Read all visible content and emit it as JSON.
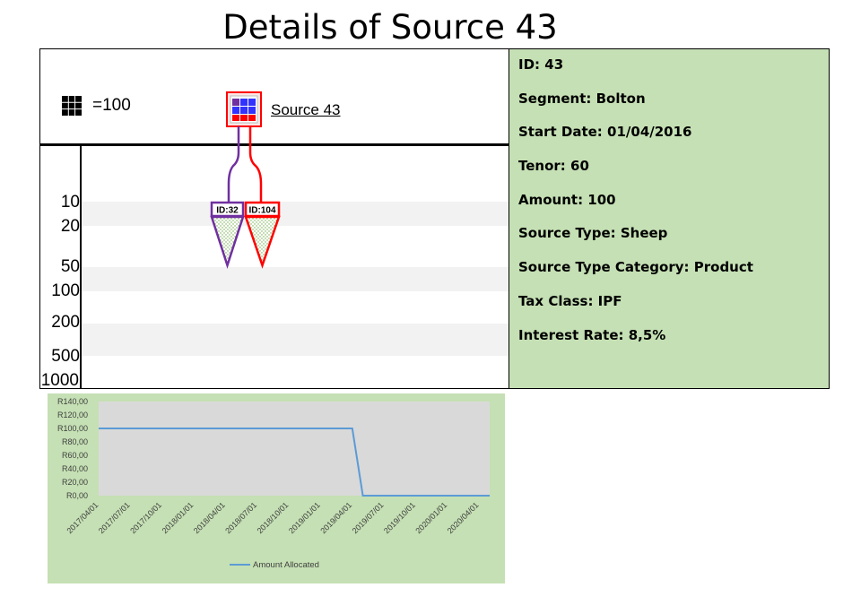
{
  "title": "Details of Source 43",
  "diagram": {
    "scale_legend": "=100",
    "source_label": "Source 43",
    "y_ticks": [
      "10",
      "20",
      "50",
      "100",
      "200",
      "500",
      "1000"
    ],
    "ids": [
      "ID:32",
      "ID:104"
    ],
    "colors": {
      "allocation_1": "#7030a0",
      "allocation_2": "#ff0000",
      "box_blue": "#3333ff",
      "box_red": "#ff0000",
      "band": "#f2f2f2",
      "fill_dots": "#70ad47"
    }
  },
  "details": [
    "ID: 43",
    "Segment: Bolton",
    "Start Date: 01/04/2016",
    "Tenor: 60",
    "Amount: 100",
    "Source Type: Sheep",
    "Source Type Category: Product",
    "Tax Class: IPF",
    "Interest Rate: 8,5%"
  ],
  "chart_data": {
    "type": "line",
    "x": [
      "2017/04/01",
      "2017/07/01",
      "2017/10/01",
      "2018/01/01",
      "2018/04/01",
      "2018/07/01",
      "2018/10/01",
      "2019/01/01",
      "2019/04/01",
      "2019/07/01",
      "2019/10/01",
      "2020/01/01",
      "2020/04/01"
    ],
    "series": [
      {
        "name": "Amount Allocated",
        "color": "#5b9bd5",
        "points": [
          [
            "2017/04/01",
            100
          ],
          [
            "2019/04/01",
            100
          ],
          [
            "2019/05/01",
            0
          ],
          [
            "2020/05/01",
            0
          ]
        ]
      }
    ],
    "y_ticks": [
      "R0,00",
      "R20,00",
      "R40,00",
      "R60,00",
      "R80,00",
      "R100,00",
      "R120,00",
      "R140,00"
    ],
    "ylim": [
      0,
      140
    ],
    "legend": "bottom",
    "plot_background": "#d9d9d9",
    "panel_background": "#c5e0b4"
  }
}
